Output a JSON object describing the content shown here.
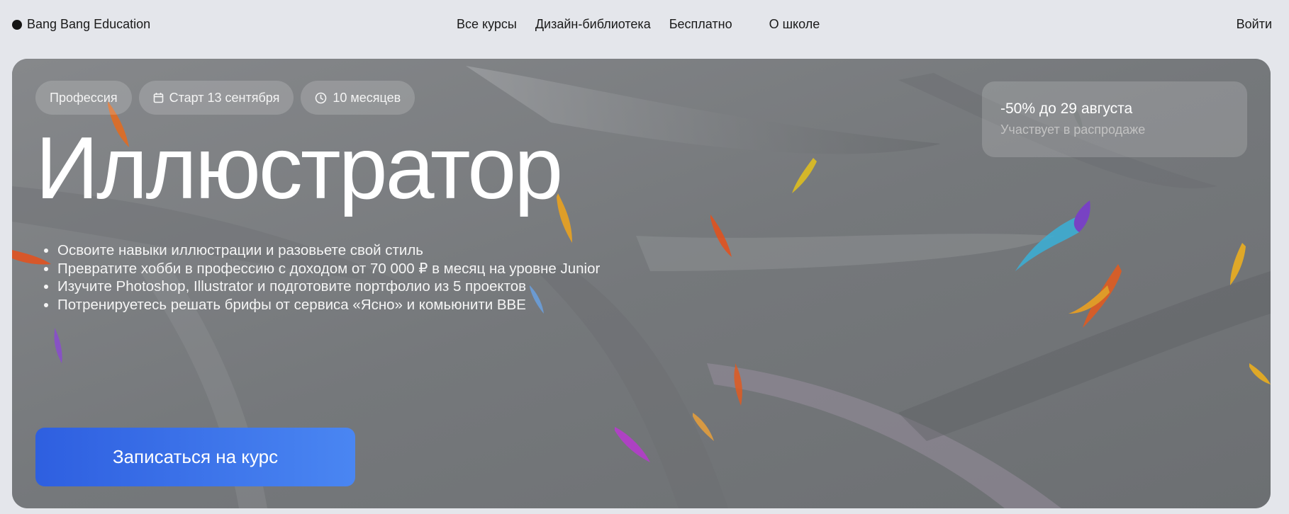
{
  "header": {
    "logo_text": "Bang Bang Education",
    "nav": [
      {
        "label": "Все курсы"
      },
      {
        "label": "Дизайн-библиотека"
      },
      {
        "label": "Бесплатно"
      },
      {
        "label": "О школе"
      }
    ],
    "login_label": "Войти"
  },
  "hero": {
    "tags": [
      {
        "label": "Профессия",
        "icon": ""
      },
      {
        "label": "Старт 13 сентября",
        "icon": "calendar-icon"
      },
      {
        "label": "10 месяцев",
        "icon": "clock-icon"
      }
    ],
    "title": "Иллюстратор",
    "bullets": [
      "Освоите навыки иллюстрации и разовьете свой стиль",
      "Превратите хобби в профессию с доходом от 70 000 ₽ в месяц на уровне Junior",
      "Изучите Photoshop, Illustrator и подготовите портфолио из 5 проектов",
      "Потренируетесь решать брифы от сервиса «Ясно» и комьюнити BBE"
    ],
    "cta_label": "Записаться на курс",
    "promo": {
      "title": "-50% до 29 августа",
      "subtitle": "Участвует в распродаже"
    }
  },
  "colors": {
    "page_background": "#e4e6eb",
    "hero_overlay": "#777a7d",
    "cta_gradient_start": "#2e5fe0",
    "cta_gradient_end": "#4a86f2"
  }
}
